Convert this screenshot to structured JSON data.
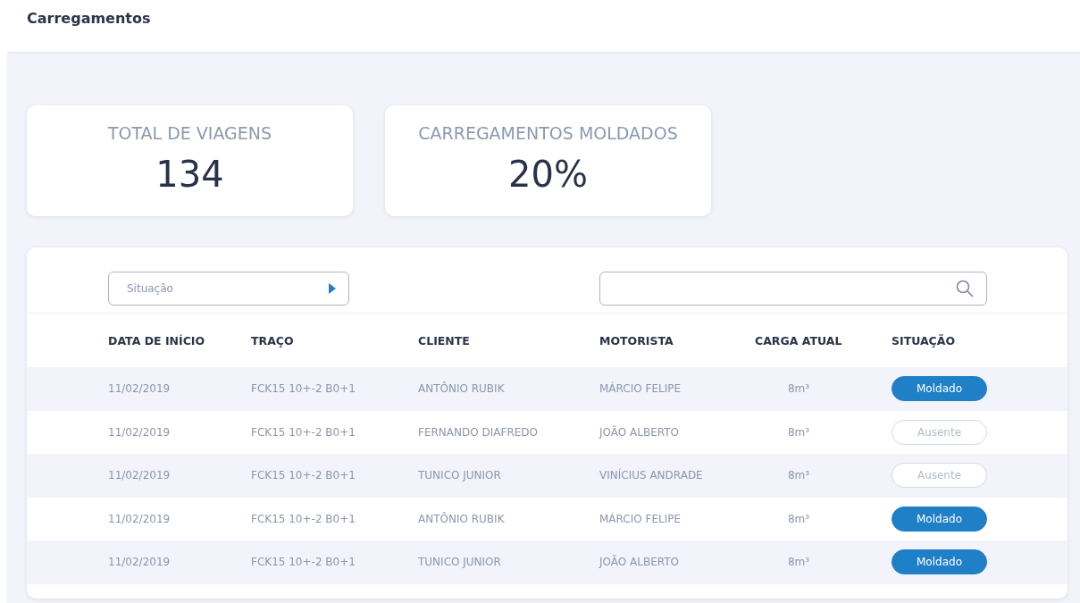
{
  "page_title": "Carregamentos",
  "stats": [
    {
      "label": "TOTAL DE VIAGENS",
      "value": "134"
    },
    {
      "label": "CARREGAMENTOS MOLDADOS",
      "value": "20%"
    }
  ],
  "filter": {
    "placeholder": "Situação"
  },
  "table": {
    "columns": [
      "DATA DE INÍCIO",
      "TRAÇO",
      "CLIENTE",
      "MOTORISTA",
      "CARGA ATUAL",
      "SITUAÇÃO"
    ],
    "rows": [
      {
        "date": "11/02/2019",
        "traco": "FCK15 10+-2 B0+1",
        "cliente": "ANTÔNIO RUBIK",
        "motorista": "MÁRCIO FELIPE",
        "carga": "8m³",
        "status": {
          "label": "Moldado",
          "kind": "filled"
        }
      },
      {
        "date": "11/02/2019",
        "traco": "FCK15 10+-2 B0+1",
        "cliente": "FERNANDO DIAFREDO",
        "motorista": "JOÃO ALBERTO",
        "carga": "8m³",
        "status": {
          "label": "Ausente",
          "kind": "outline"
        }
      },
      {
        "date": "11/02/2019",
        "traco": "FCK15 10+-2 B0+1",
        "cliente": "TUNICO JUNIOR",
        "motorista": "VINÍCIUS ANDRADE",
        "carga": "8m³",
        "status": {
          "label": "Ausente",
          "kind": "outline"
        }
      },
      {
        "date": "11/02/2019",
        "traco": "FCK15 10+-2 B0+1",
        "cliente": "ANTÔNIO RUBIK",
        "motorista": "MÁRCIO FELIPE",
        "carga": "8m³",
        "status": {
          "label": "Moldado",
          "kind": "filled"
        }
      },
      {
        "date": "11/02/2019",
        "traco": "FCK15 10+-2 B0+1",
        "cliente": "TUNICO JUNIOR",
        "motorista": "JOÃO ALBERTO",
        "carga": "8m³",
        "status": {
          "label": "Moldado",
          "kind": "filled"
        }
      }
    ]
  }
}
